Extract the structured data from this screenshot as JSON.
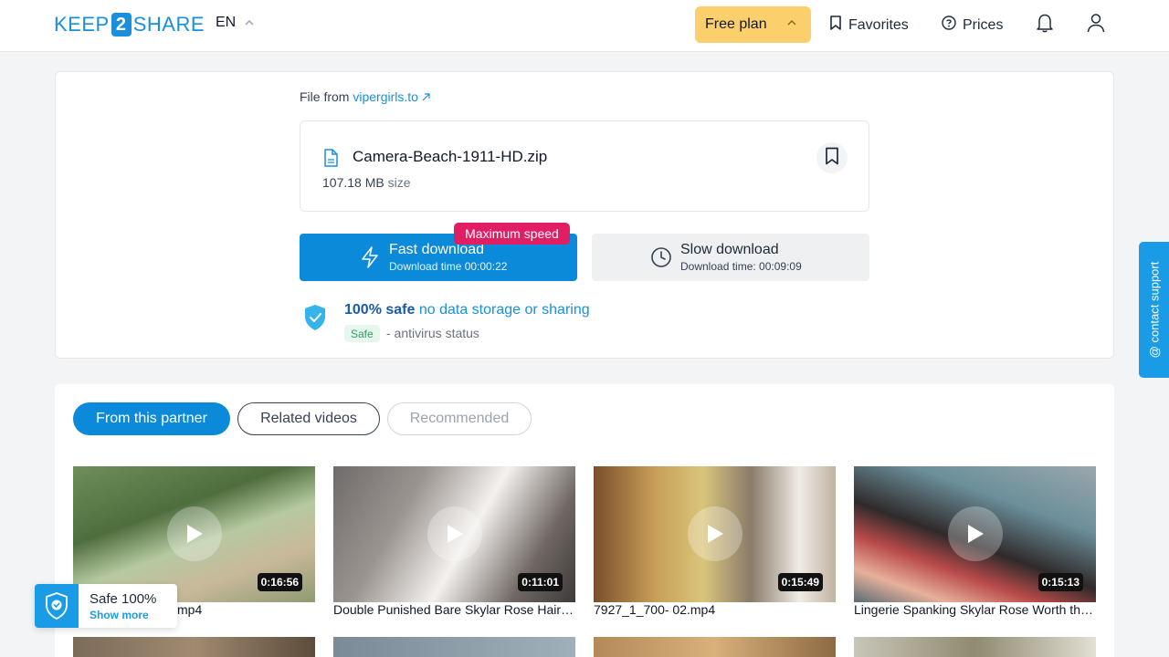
{
  "header": {
    "logo_pre": "KEEP",
    "logo_num": "2",
    "logo_post": "SHARE",
    "language": "EN",
    "plan_label": "Free plan",
    "favorites_label": "Favorites",
    "prices_label": "Prices"
  },
  "file": {
    "from_label": "File from",
    "source_link": "vipergirls.to",
    "name": "Camera-Beach-1911-HD.zip",
    "size_value": "107.18 MB",
    "size_label": "size"
  },
  "download": {
    "badge": "Maximum speed",
    "fast_label": "Fast download",
    "fast_time": "Download time 00:00:22",
    "slow_label": "Slow download",
    "slow_time": "Download time: 00:09:09"
  },
  "safety": {
    "safe_bold": "100% safe",
    "safe_rest": "no data storage or sharing",
    "status_pill": "Safe",
    "status_text": "- antivirus status"
  },
  "tabs": [
    {
      "label": "From this partner",
      "active": true
    },
    {
      "label": "Related videos",
      "active": false
    },
    {
      "label": "Recommended",
      "active": false
    }
  ],
  "videos": [
    {
      "title": "mp4",
      "duration": "0:16:56"
    },
    {
      "title": "Double Punished Bare Skylar Rose Hair…",
      "duration": "0:11:01"
    },
    {
      "title": "7927_1_700- 02.mp4",
      "duration": "0:15:49"
    },
    {
      "title": "Lingerie Spanking Skylar Rose Worth th…",
      "duration": "0:15:13"
    }
  ],
  "support_tab": "@ contact support",
  "safe_widget": {
    "title": "Safe 100%",
    "link": "Show more"
  },
  "colors": {
    "brand_blue": "#0a8ad8",
    "plan_yellow": "#fbcf6b",
    "badge_pink": "#e11d63",
    "safe_green": "#2e9d6b"
  }
}
